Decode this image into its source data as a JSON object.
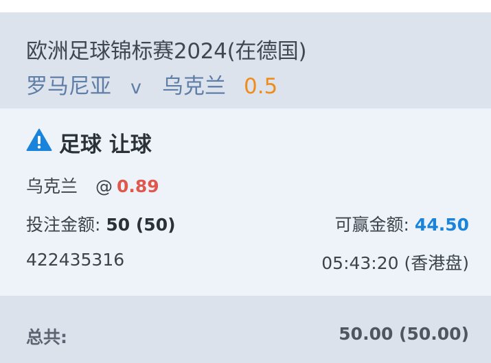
{
  "match": {
    "league": "欧洲足球锦标赛2024(在德国)",
    "home_team": "罗马尼亚",
    "vs": "v",
    "away_team": "乌克兰",
    "handicap": "0.5"
  },
  "bet": {
    "icon": "warning-icon",
    "title": "足球 让球",
    "selection_team": "乌克兰",
    "at_symbol": "@",
    "odds": "0.89",
    "stake_label": "投注金额:",
    "stake_value": "50 (50)",
    "win_label": "可赢金额:",
    "win_value": "44.50",
    "bet_id": "422435316",
    "time": "05:43:20 (香港盘)"
  },
  "total": {
    "label": "总共:",
    "value": "50.00 (50.00)"
  },
  "colors": {
    "header_bg": "#dde3ec",
    "card_bg": "#eef3fa",
    "team_blue": "#5f7ea7",
    "handicap_orange": "#ef8c1e",
    "odds_red": "#e0574b",
    "win_blue": "#1a84dc",
    "warning_blue": "#1a84dc"
  }
}
